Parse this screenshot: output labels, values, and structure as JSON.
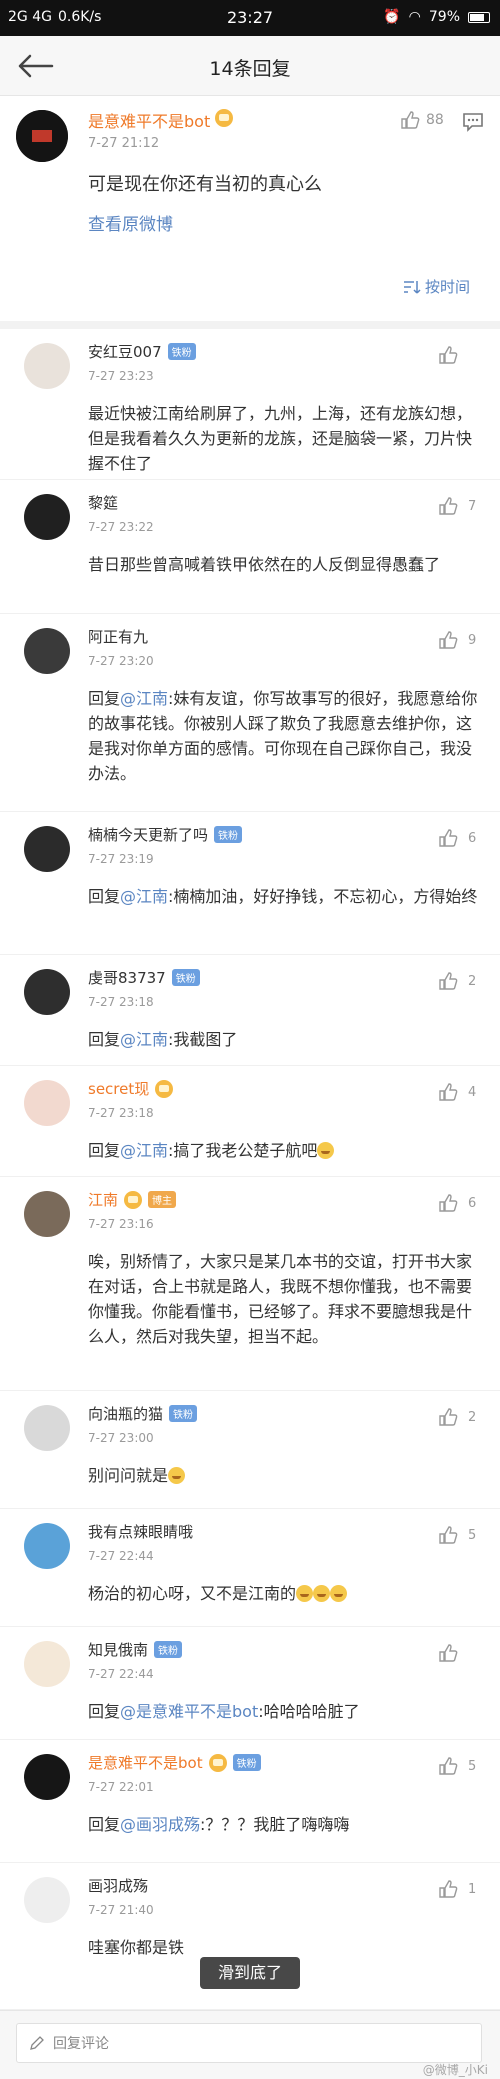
{
  "statusbar": {
    "network": "2G 4G",
    "speed": "0.6K/s",
    "time": "23:27",
    "battery": "79%",
    "battery_level": 0.79
  },
  "header": {
    "title": "14条回复"
  },
  "original": {
    "author": "是意难平不是bot",
    "time": "7-27 21:12",
    "likes": "88",
    "content": "可是现在你还有当初的真心么",
    "view_link": "查看原微博",
    "sort_label": "按时间"
  },
  "replies": [
    {
      "name": "安红豆007",
      "badge": "铁粉",
      "time": "7-27 23:23",
      "likes": "",
      "text": "最近快被江南给刷屏了，九州，上海，还有龙族幻想，但是我看着久久为更新的龙族，还是脑袋一紧，刀片快握不住了"
    },
    {
      "name": "黎筵",
      "badge": "",
      "time": "7-27 23:22",
      "likes": "7",
      "text": "昔日那些曾高喊着铁甲依然在的人反倒显得愚蠢了"
    },
    {
      "name": "阿正有九",
      "badge": "",
      "time": "7-27 23:20",
      "likes": "9",
      "prefix": "回复",
      "mention": "@江南",
      "text": ":妹有友谊，你写故事写的很好，我愿意给你的故事花钱。你被别人踩了欺负了我愿意去维护你，这是我对你单方面的感情。可你现在自己踩你自己，我没办法。"
    },
    {
      "name": "楠楠今天更新了吗",
      "badge": "铁粉",
      "time": "7-27 23:19",
      "likes": "6",
      "prefix": "回复",
      "mention": "@江南",
      "text": ":楠楠加油，好好挣钱，不忘初心，方得始终"
    },
    {
      "name": "虔哥83737",
      "badge": "铁粉",
      "time": "7-27 23:18",
      "likes": "2",
      "prefix": "回复",
      "mention": "@江南",
      "text": ":我截图了"
    },
    {
      "name": "secret现",
      "badge": "",
      "time": "7-27 23:18",
      "likes": "4",
      "prefix": "回复",
      "mention": "@江南",
      "text": ":搞了我老公楚子航吧"
    },
    {
      "name": "江南",
      "badge": "博主",
      "time": "7-27 23:16",
      "likes": "6",
      "text": "唉，别矫情了，大家只是某几本书的交谊，打开书大家在对话，合上书就是路人，我既不想你懂我，也不需要你懂我。你能看懂书，已经够了。拜求不要臆想我是什么人，然后对我失望，担当不起。"
    },
    {
      "name": "向油瓶的猫",
      "badge": "铁粉",
      "time": "7-27 23:00",
      "likes": "2",
      "text": "别问问就是"
    },
    {
      "name": "我有点辣眼睛哦",
      "badge": "",
      "time": "7-27 22:44",
      "likes": "5",
      "text": "杨治的初心呀，又不是江南的"
    },
    {
      "name": "知見俄南",
      "badge": "铁粉",
      "time": "7-27 22:44",
      "likes": "",
      "prefix": "回复",
      "mention": "@是意难平不是bot",
      "text": ":哈哈哈哈脏了"
    },
    {
      "name": "是意难平不是bot",
      "badge": "铁粉",
      "time": "7-27 22:01",
      "likes": "5",
      "prefix": "回复",
      "mention": "@画羽成殇",
      "text": ":？？？我脏了嗨嗨嗨"
    },
    {
      "name": "画羽成殇",
      "badge": "",
      "time": "7-27 21:40",
      "likes": "1",
      "text": "哇塞你都是铁"
    }
  ],
  "toast": "滑到底了",
  "footer": {
    "placeholder": "回复评论",
    "watermark": "@微博_小Ki"
  },
  "colors": {
    "accent": "#ef7a2a",
    "link": "#5b86c2",
    "badge": "#6b9fe0"
  }
}
